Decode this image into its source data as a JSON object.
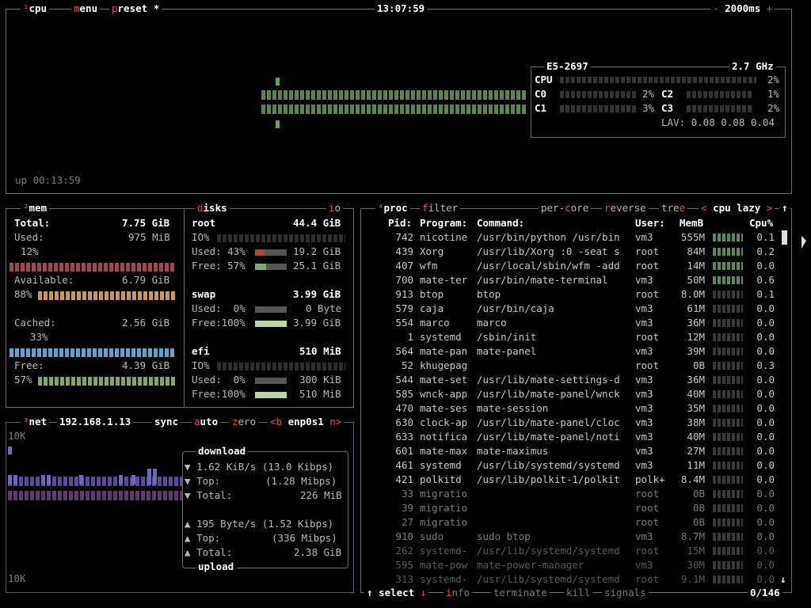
{
  "cpu_box": {
    "tab_num": "¹",
    "tab_cpu": "cpu",
    "menu_m": "m",
    "menu_rest": "enu",
    "preset_p": "p",
    "preset_rest": "reset",
    "preset_star": "*",
    "clock": "13:07:59",
    "minus": "-",
    "interval": "2000ms",
    "plus": "+",
    "uptime": "up 00:13:59",
    "model": "E5-2697",
    "freq": "2.7 GHz",
    "cpu_label": "CPU",
    "cpu_total_pct": "2%",
    "cores": [
      {
        "name": "C0",
        "pct": "2%",
        "level": 0.02
      },
      {
        "name": "C1",
        "pct": "3%",
        "level": 0.03
      },
      {
        "name": "C2",
        "pct": "1%",
        "level": 0.01
      },
      {
        "name": "C3",
        "pct": "2%",
        "level": 0.02
      }
    ],
    "lav": "LAV: 0.08 0.08 0.04"
  },
  "mem": {
    "tab_num": "²",
    "title": "mem",
    "total_label": "Total:",
    "total_val": "7.75 GiB",
    "used_label": "Used:",
    "used_val": "975 MiB",
    "used_pct": "12%",
    "avail_label": "Available:",
    "avail_val": "6.79 GiB",
    "avail_pct": "88%",
    "cached_label": "Cached:",
    "cached_val": "2.56 GiB",
    "cached_pct": "33%",
    "free_label": "Free:",
    "free_val": "4.39 GiB",
    "free_pct": "57%"
  },
  "disks": {
    "title_d": "d",
    "title_rest": "isks",
    "io_i": "i",
    "io_rest": "o",
    "root_name": "root",
    "root_size": "44.4 GiB",
    "io_label": "IO%",
    "root_used": "Used: 43%",
    "root_used_val": "19.2 GiB",
    "root_free": "Free: 57%",
    "root_free_val": "25.1 GiB",
    "swap_name": "swap",
    "swap_size": "3.99 GiB",
    "swap_used": "Used:  0%",
    "swap_used_val": "0 Byte",
    "swap_free": "Free:100%",
    "swap_free_val": "3.99 GiB",
    "efi_name": "efi",
    "efi_size": "510 MiB",
    "efi_used": "Used:  0%",
    "efi_used_val": "300 KiB",
    "efi_free": "Free:100%",
    "efi_free_val": "510 MiB"
  },
  "net": {
    "tab_num": "³",
    "title": "net",
    "ip": "192.168.1.13",
    "sync": "sync",
    "auto_a": "a",
    "auto_rest": "uto",
    "zero_z": "z",
    "zero_rest": "ero",
    "prev": "<b",
    "iface": "enp0s1",
    "next": "n>",
    "scale_top": "10K",
    "scale_bottom": "10K",
    "download_title": "download",
    "dl_rate": "1.62 KiB/s (13.0 Kibps)",
    "dl_top_label": "Top:",
    "dl_top": "(1.28 Mibps)",
    "dl_total_label": "Total:",
    "dl_total": "226 MiB",
    "ul_rate": "195 Byte/s (1.52 Kibps)",
    "ul_top_label": "Top:",
    "ul_top": "(336 Mibps)",
    "ul_total_label": "Total:",
    "ul_total": "2.38 GiB",
    "upload_title": "upload"
  },
  "proc": {
    "tab_num": "⁴",
    "title": "proc",
    "filter_f": "f",
    "filter_rest": "ilter",
    "percore_pre": "per-",
    "percore_c": "c",
    "percore_rest": "ore",
    "reverse_r": "r",
    "reverse_rest": "everse",
    "tree_pre": "tre",
    "tree_e": "e",
    "sort_prev": "<",
    "sort_name": "cpu lazy",
    "sort_next": ">",
    "col_pid": "Pid:",
    "col_program": "Program:",
    "col_command": "Command:",
    "col_user": "User:",
    "col_mem": "MemB",
    "col_cpu": "Cpu%",
    "rows": [
      {
        "pid": "742",
        "prog": "nicotine",
        "cmd": "/usr/bin/python /usr/bin",
        "user": "vm3",
        "mem": "555M",
        "cpu": "0.1"
      },
      {
        "pid": "439",
        "prog": "Xorg",
        "cmd": "/usr/lib/Xorg :0 -seat s",
        "user": "root",
        "mem": "84M",
        "cpu": "0.2"
      },
      {
        "pid": "407",
        "prog": "wfm",
        "cmd": "/usr/local/sbin/wfm -add",
        "user": "root",
        "mem": "14M",
        "cpu": "0.0"
      },
      {
        "pid": "700",
        "prog": "mate-ter",
        "cmd": "/usr/bin/mate-terminal",
        "user": "vm3",
        "mem": "50M",
        "cpu": "0.6"
      },
      {
        "pid": "913",
        "prog": "btop",
        "cmd": "btop",
        "user": "root",
        "mem": "8.0M",
        "cpu": "0.1"
      },
      {
        "pid": "579",
        "prog": "caja",
        "cmd": "/usr/bin/caja",
        "user": "vm3",
        "mem": "61M",
        "cpu": "0.0"
      },
      {
        "pid": "554",
        "prog": "marco",
        "cmd": "marco",
        "user": "vm3",
        "mem": "36M",
        "cpu": "0.0"
      },
      {
        "pid": "1",
        "prog": "systemd",
        "cmd": "/sbin/init",
        "user": "root",
        "mem": "12M",
        "cpu": "0.0"
      },
      {
        "pid": "564",
        "prog": "mate-pan",
        "cmd": "mate-panel",
        "user": "vm3",
        "mem": "39M",
        "cpu": "0.0"
      },
      {
        "pid": "52",
        "prog": "khugepag",
        "cmd": "",
        "user": "root",
        "mem": "0B",
        "cpu": "0.3"
      },
      {
        "pid": "544",
        "prog": "mate-set",
        "cmd": "/usr/lib/mate-settings-d",
        "user": "vm3",
        "mem": "36M",
        "cpu": "0.0"
      },
      {
        "pid": "585",
        "prog": "wnck-app",
        "cmd": "/usr/lib/mate-panel/wnck",
        "user": "vm3",
        "mem": "40M",
        "cpu": "0.0"
      },
      {
        "pid": "470",
        "prog": "mate-ses",
        "cmd": "mate-session",
        "user": "vm3",
        "mem": "35M",
        "cpu": "0.0"
      },
      {
        "pid": "630",
        "prog": "clock-ap",
        "cmd": "/usr/lib/mate-panel/cloc",
        "user": "vm3",
        "mem": "38M",
        "cpu": "0.0"
      },
      {
        "pid": "633",
        "prog": "notifica",
        "cmd": "/usr/lib/mate-panel/noti",
        "user": "vm3",
        "mem": "40M",
        "cpu": "0.0"
      },
      {
        "pid": "601",
        "prog": "mate-max",
        "cmd": "mate-maximus",
        "user": "vm3",
        "mem": "27M",
        "cpu": "0.0"
      },
      {
        "pid": "461",
        "prog": "systemd",
        "cmd": "/usr/lib/systemd/systemd",
        "user": "vm3",
        "mem": "11M",
        "cpu": "0.0"
      },
      {
        "pid": "421",
        "prog": "polkitd",
        "cmd": "/usr/lib/polkit-1/polkit",
        "user": "polk+",
        "mem": "8.4M",
        "cpu": "0.0"
      },
      {
        "pid": "33",
        "prog": "migratio",
        "cmd": "",
        "user": "root",
        "mem": "0B",
        "cpu": "0.0"
      },
      {
        "pid": "39",
        "prog": "migratio",
        "cmd": "",
        "user": "root",
        "mem": "0B",
        "cpu": "0.0"
      },
      {
        "pid": "27",
        "prog": "migratio",
        "cmd": "",
        "user": "root",
        "mem": "0B",
        "cpu": "0.0"
      },
      {
        "pid": "910",
        "prog": "sudo",
        "cmd": "sudo btop",
        "user": "vm3",
        "mem": "8.7M",
        "cpu": "0.0"
      },
      {
        "pid": "262",
        "prog": "systemd-",
        "cmd": "/usr/lib/systemd/systemd",
        "user": "root",
        "mem": "15M",
        "cpu": "0.0"
      },
      {
        "pid": "595",
        "prog": "mate-pow",
        "cmd": "mate-power-manager",
        "user": "vm3",
        "mem": "30M",
        "cpu": "0.0"
      },
      {
        "pid": "313",
        "prog": "systemd-",
        "cmd": "/usr/lib/systemd/systemd",
        "user": "root",
        "mem": "9.1M",
        "cpu": "0.0"
      }
    ],
    "footer_up": "↑",
    "footer_select": "select",
    "footer_down": "↓",
    "footer_info_i": "i",
    "footer_info_rest": "nfo",
    "footer_term_t": "t",
    "footer_term_rest": "erminate",
    "footer_kill_k": "k",
    "footer_kill_rest": "ill",
    "footer_sig_s": "s",
    "footer_sig_rest": "ignals",
    "footer_count": "0/146"
  }
}
